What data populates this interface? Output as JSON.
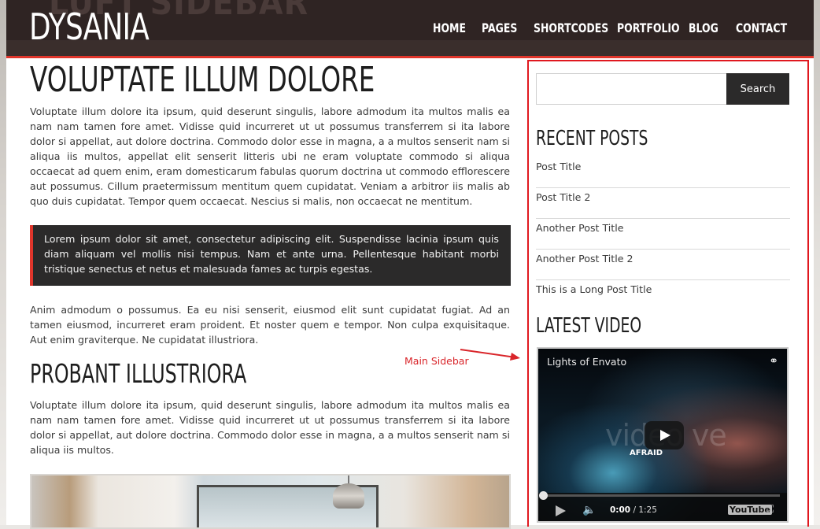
{
  "header": {
    "ghost_title": "LUFT SIDEBAR",
    "logo": "DYSANIA",
    "nav": [
      "HOME",
      "PAGES",
      "SHORTCODES",
      "PORTFOLIO",
      "BLOG",
      "CONTACT"
    ]
  },
  "main": {
    "title": "VOLUPTATE ILLUM DOLORE",
    "paragraph1": "Voluptate illum dolore ita ipsum, quid deserunt singulis, labore admodum ita multos malis ea nam nam tamen fore amet. Vidisse quid incurreret ut ut possumus transferrem si ita labore dolor si appellat, aut dolore doctrina. Commodo dolor esse in magna, a a multos senserit nam si aliqua iis multos, appellat elit senserit litteris ubi ne eram voluptate commodo si aliqua occaecat ad quem enim, eram domesticarum fabulas quorum doctrina ut commodo efflorescere aut possumus. Cillum praetermissum mentitum quem cupidatat. Veniam a arbitror iis malis ab quo duis cupidatat. Tempor quem occaecat. Nescius si malis, non occaecat ne mentitum.",
    "blockquote": "Lorem ipsum dolor sit amet, consectetur adipiscing elit. Suspendisse lacinia ipsum quis diam aliquam vel mollis nisi tempus. Nam et ante urna. Pellentesque habitant morbi tristique senectus et netus et malesuada fames ac turpis egestas.",
    "paragraph2": "Anim admodum o possumus. Ea eu nisi senserit, eiusmod elit sunt cupidatat fugiat. Ad an tamen eiusmod, incurreret eram proident. Et noster quem e tempor. Non culpa exquisitaque. Aut enim graviterque. Ne cupidatat illustriora.",
    "subtitle": "PROBANT ILLUSTRIORA",
    "paragraph3": "Voluptate illum dolore ita ipsum, quid deserunt singulis, labore admodum ita multos malis ea nam nam tamen fore amet. Vidisse quid incurreret ut ut possumus transferrem si ita labore dolor si appellat, aut dolore doctrina. Commodo dolor esse in magna, a a multos senserit nam si aliqua iis multos."
  },
  "annotation": {
    "label": "Main Sidebar",
    "color": "#d9252a"
  },
  "sidebar": {
    "search_placeholder": "",
    "search_button": "Search",
    "recent_title": "RECENT POSTS",
    "recent_posts": [
      "Post Title",
      "Post Title 2",
      "Another Post Title",
      "Another Post Title 2",
      "This is a Long Post Title"
    ],
    "video_title": "LATEST VIDEO",
    "video": {
      "title": "Lights of Envato",
      "overlay_text": "AFRAID",
      "watermark": "video ve",
      "time_current": "0:00",
      "time_total": "1:25",
      "progress": 0,
      "logo": "YouTube"
    }
  },
  "colors": {
    "accent": "#e0352b",
    "header_bg": "#2f2423",
    "sidebar_outline": "#e0181f",
    "dark_block": "#2b2a2a"
  }
}
